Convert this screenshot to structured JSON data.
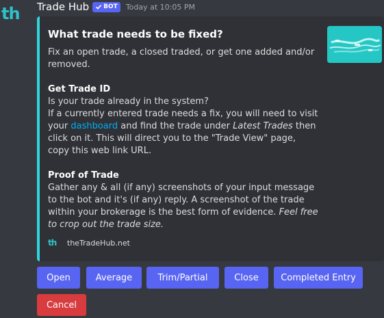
{
  "message": {
    "avatar_text": "th",
    "author": "Trade Hub",
    "bot_tag": "BOT",
    "timestamp": "Today at 10:05 PM"
  },
  "embed": {
    "accent_color": "#2fd6dc",
    "title": "What trade needs to be fixed?",
    "intro": "Fix an open trade, a closed traded, or get one added and/or removed.",
    "fields": [
      {
        "name": "Get Trade ID",
        "line1": "Is your trade already in the system?",
        "line2": "If a currently entered trade needs a fix, you will need to visit your",
        "link": "dashboard",
        "mid": " and find the trade under ",
        "italic": "Latest Trades",
        "after": " then click on it. This will direct you to the \"Trade View\" page, copy this web link URL."
      },
      {
        "name": "Proof of Trade",
        "text": "Gather any & all (if any) screenshots of your input message to the bot and it's (if any) reply. A screenshot of the trade within your brokerage is the best form of evidence. ",
        "italic": "Feel free to crop out the trade size."
      }
    ],
    "footer_icon": "th",
    "footer": "theTradeHub.net"
  },
  "buttons": {
    "open": "Open",
    "average": "Average",
    "trim": "Trim/Partial",
    "close": "Close",
    "completed": "Completed Entry",
    "cancel": "Cancel"
  },
  "colors": {
    "primary": "#5865f2",
    "danger": "#d83c3e",
    "brand": "#2fc1c9"
  }
}
